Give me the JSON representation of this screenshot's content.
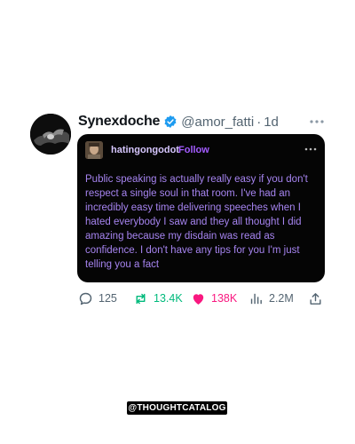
{
  "tweet": {
    "display_name": "Synexdoche",
    "handle": "@amor_fatti",
    "separator": "·",
    "time": "1d"
  },
  "embed": {
    "username": "hatingongodot",
    "follow_label": "Follow",
    "body": "Public speaking is actually really easy if you don't respect a single soul in that room. I've had an incredibly easy time delivering speeches when I hated everybody I saw and they all thought I did amazing because my disdain was read as confidence. I don't have any tips for you I'm just telling you a fact"
  },
  "actions": {
    "replies": "125",
    "retweets": "13.4K",
    "likes": "138K",
    "views": "2.2M"
  },
  "watermark": "@THOUGHTCATALOG",
  "colors": {
    "verified": "#1d9bf0",
    "retweet": "#00ba7c",
    "like": "#f91880",
    "embed_text": "#a684f0",
    "follow": "#a35cff"
  },
  "icons": [
    "verified-icon",
    "more-icon",
    "reply-icon",
    "retweet-icon",
    "heart-icon",
    "views-icon",
    "share-icon"
  ]
}
